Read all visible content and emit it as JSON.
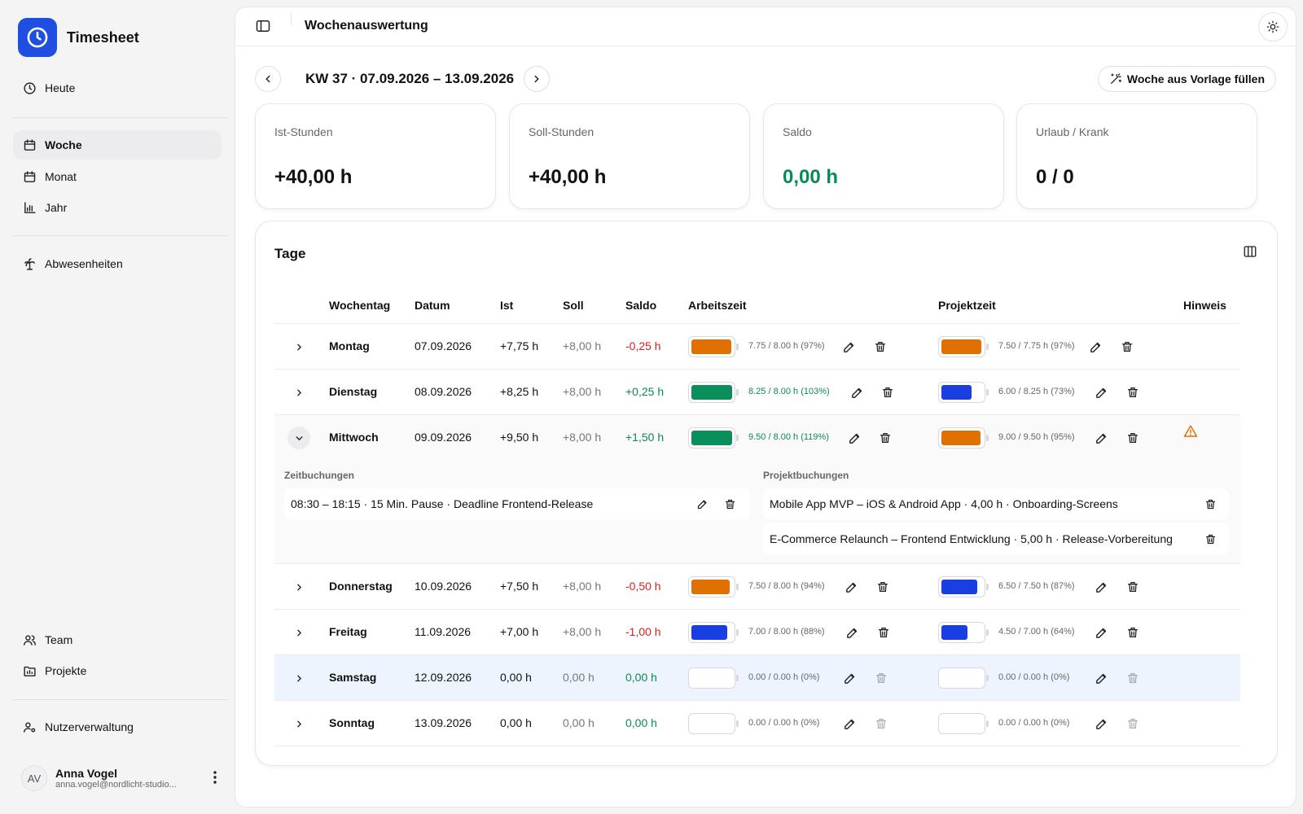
{
  "app": {
    "name": "Timesheet"
  },
  "nav": {
    "heute": "Heute",
    "woche": "Woche",
    "monat": "Monat",
    "jahr": "Jahr",
    "abwesenheiten": "Abwesenheiten",
    "team": "Team",
    "projekte": "Projekte",
    "nutzerverwaltung": "Nutzerverwaltung"
  },
  "user": {
    "initials": "AV",
    "name": "Anna Vogel",
    "email": "anna.vogel@nordlicht-studio..."
  },
  "header": {
    "title": "Wochenauswertung"
  },
  "week": {
    "label": "KW 37 · 07.09.2026 – 13.09.2026",
    "fill_button": "Woche aus Vorlage füllen"
  },
  "cards": [
    {
      "label": "Ist-Stunden",
      "value": "+40,00 h"
    },
    {
      "label": "Soll-Stunden",
      "value": "+40,00 h"
    },
    {
      "label": "Saldo",
      "value": "0,00 h"
    },
    {
      "label": "Urlaub / Krank",
      "value": "0 / 0"
    }
  ],
  "table": {
    "title": "Tage",
    "columns": {
      "wochentag": "Wochentag",
      "datum": "Datum",
      "ist": "Ist",
      "soll": "Soll",
      "saldo": "Saldo",
      "arbeitszeit": "Arbeitszeit",
      "projektzeit": "Projektzeit",
      "hinweis": "Hinweis"
    },
    "rows": [
      {
        "day": "Montag",
        "date": "07.09.2026",
        "ist": "+7,75 h",
        "soll": "+8,00 h",
        "saldo": "-0,25 h",
        "work_text": "7.75 / 8.00 h (97%)",
        "work_fraction": 0.97,
        "work_color": "#e07000",
        "proj_text": "7.50 / 7.75 h (97%)",
        "proj_fraction": 0.97,
        "proj_color": "#e07000"
      },
      {
        "day": "Dienstag",
        "date": "08.09.2026",
        "ist": "+8,25 h",
        "soll": "+8,00 h",
        "saldo": "+0,25 h",
        "work_text": "8.25 / 8.00 h (103%)",
        "work_fraction": 1.0,
        "work_color": "#0a8f5a",
        "proj_text": "6.00 / 8.25 h (73%)",
        "proj_fraction": 0.73,
        "proj_color": "#1a3fe0"
      },
      {
        "day": "Mittwoch",
        "date": "09.09.2026",
        "ist": "+9,50 h",
        "soll": "+8,00 h",
        "saldo": "+1,50 h",
        "work_text": "9.50 / 8.00 h (119%)",
        "work_fraction": 1.0,
        "work_color": "#0a8f5a",
        "proj_text": "9.00 / 9.50 h (95%)",
        "proj_fraction": 0.95,
        "proj_color": "#e07000"
      },
      {
        "day": "Donnerstag",
        "date": "10.09.2026",
        "ist": "+7,50 h",
        "soll": "+8,00 h",
        "saldo": "-0,50 h",
        "work_text": "7.50 / 8.00 h (94%)",
        "work_fraction": 0.94,
        "work_color": "#e07000",
        "proj_text": "6.50 / 7.50 h (87%)",
        "proj_fraction": 0.87,
        "proj_color": "#1a3fe0"
      },
      {
        "day": "Freitag",
        "date": "11.09.2026",
        "ist": "+7,00 h",
        "soll": "+8,00 h",
        "saldo": "-1,00 h",
        "work_text": "7.00 / 8.00 h (88%)",
        "work_fraction": 0.88,
        "work_color": "#1a3fe0",
        "proj_text": "4.50 / 7.00 h (64%)",
        "proj_fraction": 0.64,
        "proj_color": "#1a3fe0"
      },
      {
        "day": "Samstag",
        "date": "12.09.2026",
        "ist": "0,00 h",
        "soll": "0,00 h",
        "saldo": "0,00 h",
        "work_text": "0.00 / 0.00 h (0%)",
        "work_fraction": 0,
        "work_color": "#cccccc",
        "proj_text": "0.00 / 0.00 h (0%)",
        "proj_fraction": 0,
        "proj_color": "#cccccc"
      },
      {
        "day": "Sonntag",
        "date": "13.09.2026",
        "ist": "0,00 h",
        "soll": "0,00 h",
        "saldo": "0,00 h",
        "work_text": "0.00 / 0.00 h (0%)",
        "work_fraction": 0,
        "work_color": "#cccccc",
        "proj_text": "0.00 / 0.00 h (0%)",
        "proj_fraction": 0,
        "proj_color": "#cccccc"
      }
    ]
  },
  "details": {
    "time_heading": "Zeitbuchungen",
    "project_heading": "Projektbuchungen",
    "time_entries": [
      "08:30 – 18:15 · 15 Min. Pause · Deadline Frontend-Release"
    ],
    "project_entries": [
      "Mobile App MVP – iOS & Android App · 4,00 h · Onboarding-Screens",
      "E-Commerce Relaunch – Frontend Entwicklung · 5,00 h · Release-Vorbereitung"
    ]
  },
  "colors": {
    "accent": "#1f4fe0",
    "positive": "#0b8a55",
    "negative": "#d61f1f",
    "warning": "#e07000"
  },
  "icons": [
    "clock-icon",
    "calendar-icon",
    "bar-chart-icon",
    "palm-tree-icon",
    "users-icon",
    "folder-icon",
    "user-cog-icon",
    "sidebar-toggle-icon",
    "sun-icon",
    "chevron-left-icon",
    "chevron-right-icon",
    "wand-icon",
    "columns-icon",
    "pencil-icon",
    "trash-icon",
    "warning-icon",
    "kebab-icon"
  ]
}
